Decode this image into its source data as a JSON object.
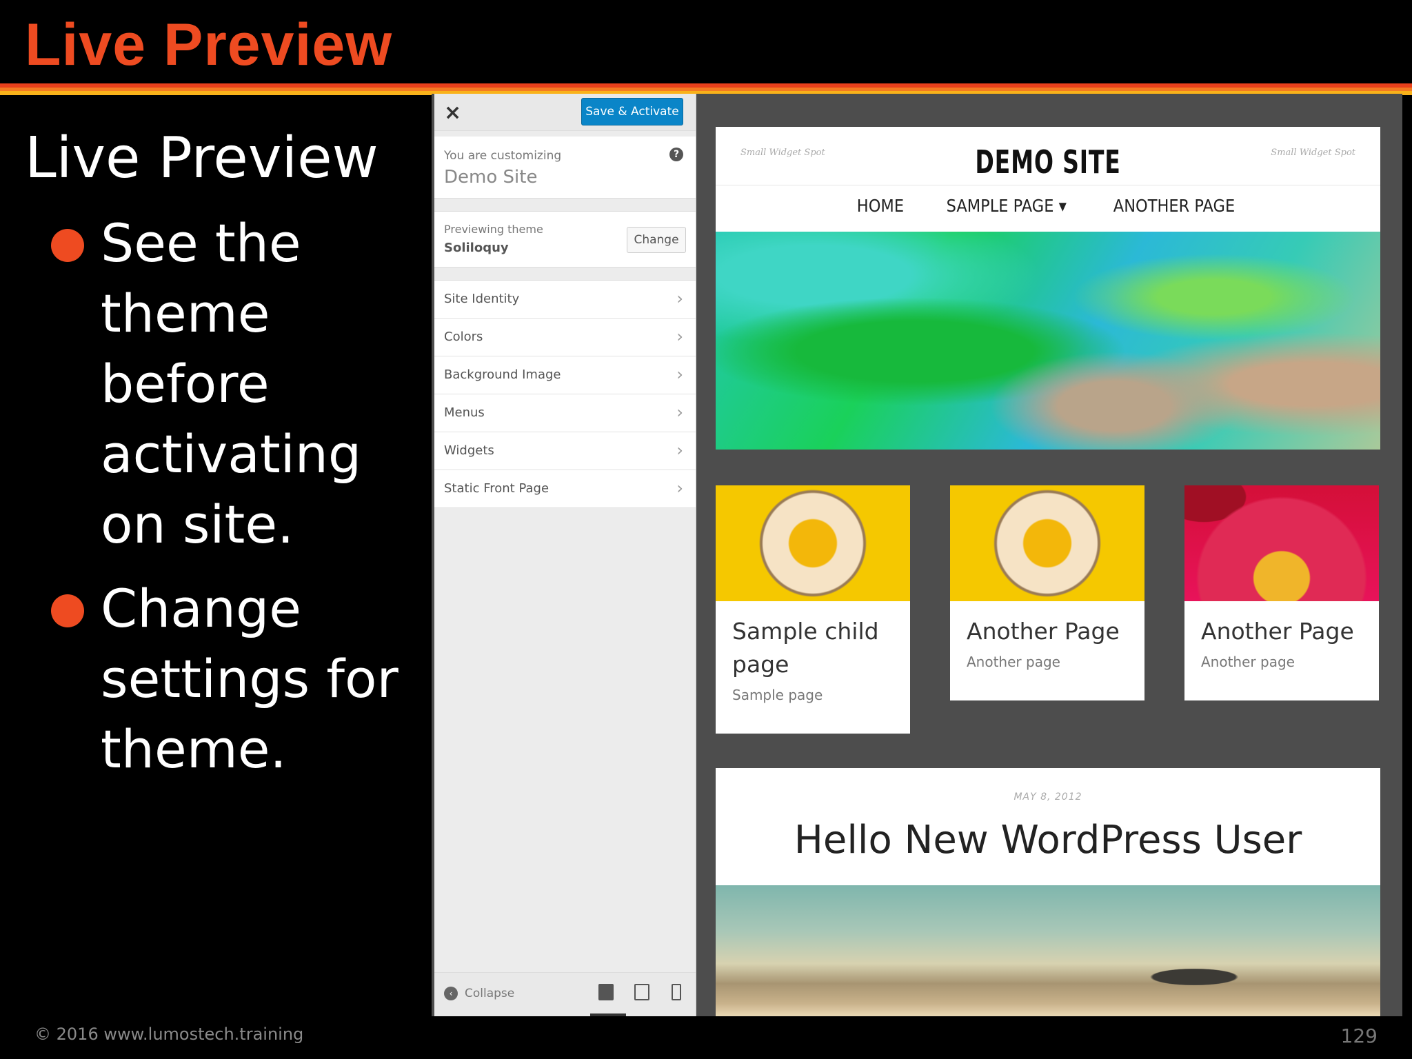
{
  "slide": {
    "title": "Live Preview",
    "heading": "Live Preview",
    "bullets": [
      "See the theme before activating on site.",
      "Change settings for theme."
    ],
    "footer_left": "© 2016  www.lumostech.training",
    "page_number": "129",
    "colors": {
      "accent": "#ee4b21",
      "stripe_mid": "#f47a22",
      "stripe_low": "#f9b21a"
    }
  },
  "customizer": {
    "close_icon": "×",
    "save_label": "Save & Activate",
    "customizing_label": "You are customizing",
    "site_name": "Demo Site",
    "help_icon": "?",
    "previewing_label": "Previewing theme",
    "theme_name": "Soliloquy",
    "change_label": "Change",
    "menu": [
      {
        "label": "Site Identity"
      },
      {
        "label": "Colors"
      },
      {
        "label": "Background Image"
      },
      {
        "label": "Menus"
      },
      {
        "label": "Widgets"
      },
      {
        "label": "Static Front Page"
      }
    ],
    "chevron": "›",
    "collapse_label": "Collapse",
    "collapse_icon": "‹",
    "devices": [
      "desktop-icon",
      "tablet-icon",
      "mobile-icon"
    ],
    "accent": "#0a85c8"
  },
  "preview": {
    "widget_left": "Small Widget Spot",
    "widget_right": "Small Widget Spot",
    "site_title": "DEMO SITE",
    "nav": [
      "HOME",
      "SAMPLE PAGE ▾",
      "ANOTHER PAGE"
    ],
    "cards": [
      {
        "title": "Sample child page",
        "sub": "Sample page"
      },
      {
        "title": "Another Page",
        "sub": "Another page"
      },
      {
        "title": "Another Page",
        "sub": "Another page"
      }
    ],
    "post": {
      "date": "MAY 8, 2012",
      "title": "Hello New WordPress User"
    }
  }
}
